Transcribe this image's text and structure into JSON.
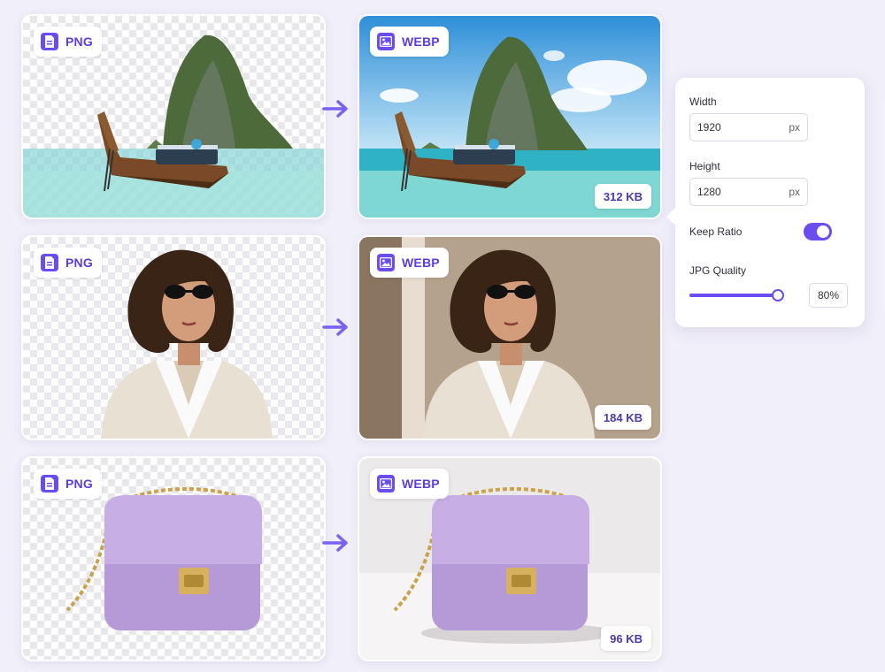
{
  "rows": [
    {
      "source": {
        "format": "PNG",
        "icon": "document-icon"
      },
      "output": {
        "format": "WEBP",
        "icon": "image-icon",
        "size": "312 KB"
      }
    },
    {
      "source": {
        "format": "PNG",
        "icon": "document-icon"
      },
      "output": {
        "format": "WEBP",
        "icon": "image-icon",
        "size": "184 KB"
      }
    },
    {
      "source": {
        "format": "PNG",
        "icon": "document-icon"
      },
      "output": {
        "format": "WEBP",
        "icon": "image-icon",
        "size": "96 KB"
      }
    }
  ],
  "settings": {
    "width_label": "Width",
    "width_value": "1920",
    "width_unit": "px",
    "height_label": "Height",
    "height_value": "1280",
    "height_unit": "px",
    "keep_ratio_label": "Keep Ratio",
    "keep_ratio_on": true,
    "quality_label": "JPG Quality",
    "quality_value": "80%",
    "quality_fraction": 0.8
  },
  "colors": {
    "accent": "#6a4cf0",
    "background": "#f1eff9"
  }
}
